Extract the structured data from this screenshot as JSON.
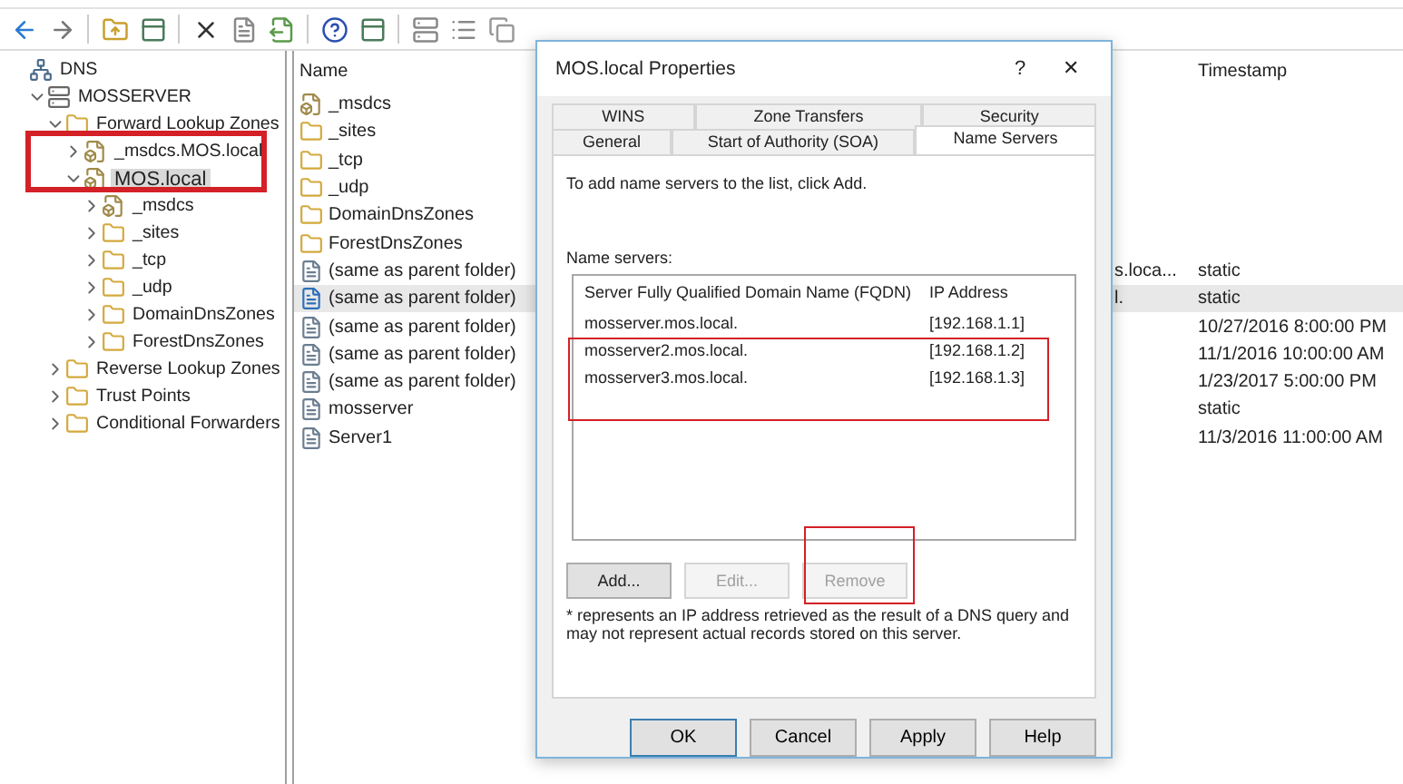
{
  "toolbar": {
    "buttons": [
      {
        "kind": "back"
      },
      {
        "kind": "forward"
      },
      {
        "kind": "sep"
      },
      {
        "kind": "folder-up"
      },
      {
        "kind": "panel"
      },
      {
        "kind": "sep"
      },
      {
        "kind": "delete"
      },
      {
        "kind": "properties"
      },
      {
        "kind": "export"
      },
      {
        "kind": "sep"
      },
      {
        "kind": "help"
      },
      {
        "kind": "panel"
      },
      {
        "kind": "sep"
      },
      {
        "kind": "server"
      },
      {
        "kind": "list"
      },
      {
        "kind": "copy"
      }
    ]
  },
  "tree": [
    {
      "label": "DNS",
      "kind": "dns",
      "selected": false,
      "children": [
        {
          "label": "MOSSERVER",
          "kind": "server",
          "expanded": true,
          "selected": false,
          "children": [
            {
              "label": "Forward Lookup Zones",
              "kind": "folder",
              "expanded": true,
              "selected": false,
              "children": [
                {
                  "label": "_msdcs.MOS.local",
                  "kind": "zone",
                  "expanded": false,
                  "selected": false
                },
                {
                  "label": "MOS.local",
                  "kind": "zone",
                  "expanded": true,
                  "selected": true,
                  "children": [
                    {
                      "label": "_msdcs",
                      "kind": "zone",
                      "expanded": false,
                      "selected": false
                    },
                    {
                      "label": "_sites",
                      "kind": "folder",
                      "expanded": false,
                      "selected": false
                    },
                    {
                      "label": "_tcp",
                      "kind": "folder",
                      "expanded": false,
                      "selected": false
                    },
                    {
                      "label": "_udp",
                      "kind": "folder",
                      "expanded": false,
                      "selected": false
                    },
                    {
                      "label": "DomainDnsZones",
                      "kind": "folder",
                      "expanded": false,
                      "selected": false
                    },
                    {
                      "label": "ForestDnsZones",
                      "kind": "folder",
                      "expanded": false,
                      "selected": false
                    }
                  ]
                }
              ]
            },
            {
              "label": "Reverse Lookup Zones",
              "kind": "folder",
              "expanded": false,
              "selected": false
            },
            {
              "label": "Trust Points",
              "kind": "folder",
              "expanded": false,
              "selected": false
            },
            {
              "label": "Conditional Forwarders",
              "kind": "folder",
              "expanded": false,
              "selected": false
            }
          ]
        }
      ]
    }
  ],
  "list": {
    "columns": [
      "Name",
      "Timestamp"
    ],
    "rows": [
      {
        "name": "_msdcs",
        "kind": "zone",
        "selected": false
      },
      {
        "name": "_sites",
        "kind": "folder",
        "selected": false
      },
      {
        "name": "_tcp",
        "kind": "folder",
        "selected": false
      },
      {
        "name": "_udp",
        "kind": "folder",
        "selected": false
      },
      {
        "name": "DomainDnsZones",
        "kind": "folder",
        "selected": false
      },
      {
        "name": "ForestDnsZones",
        "kind": "folder",
        "selected": false
      },
      {
        "name": "(same as parent folder)",
        "kind": "record",
        "column_2": "s.loca...",
        "timestamp": "static",
        "selected": false
      },
      {
        "name": "(same as parent folder)",
        "kind": "record-blue",
        "column_2": "l.",
        "timestamp": "static",
        "selected": true
      },
      {
        "name": "(same as parent folder)",
        "kind": "record",
        "timestamp": "10/27/2016 8:00:00 PM",
        "selected": false
      },
      {
        "name": "(same as parent folder)",
        "kind": "record",
        "timestamp": "11/1/2016 10:00:00 AM",
        "selected": false
      },
      {
        "name": "(same as parent folder)",
        "kind": "record",
        "timestamp": "1/23/2017 5:00:00 PM",
        "selected": false
      },
      {
        "name": "mosserver",
        "kind": "record",
        "timestamp": "static",
        "selected": false
      },
      {
        "name": "Server1",
        "kind": "record",
        "timestamp": "11/3/2016 11:00:00 AM",
        "selected": false
      }
    ]
  },
  "dialog": {
    "title": "MOS.local Properties",
    "help": "?",
    "close": "✕",
    "tab_rows": [
      [
        {
          "label": "WINS",
          "selected": false
        },
        {
          "label": "Zone Transfers",
          "selected": false
        },
        {
          "label": "Security",
          "selected": false
        }
      ],
      [
        {
          "label": "General",
          "selected": false
        },
        {
          "label": "Start of Authority (SOA)",
          "selected": false
        },
        {
          "label": "Name Servers",
          "selected": true
        }
      ]
    ],
    "instruction": "To add name servers to the list, click Add.",
    "list_label": "Name servers:",
    "columns": [
      "Server Fully Qualified Domain Name (FQDN)",
      "IP Address"
    ],
    "servers": [
      {
        "fqdn": "mosserver.mos.local.",
        "ip": "[192.168.1.1]"
      },
      {
        "fqdn": "mosserver2.mos.local.",
        "ip": "[192.168.1.2]"
      },
      {
        "fqdn": "mosserver3.mos.local.",
        "ip": "[192.168.1.3]"
      }
    ],
    "list_buttons": [
      {
        "label": "Add...",
        "disabled": false
      },
      {
        "label": "Edit...",
        "disabled": true
      },
      {
        "label": "Remove",
        "disabled": true
      }
    ],
    "note": "* represents an IP address retrieved as the result of a DNS query and may not represent actual records stored on this server.",
    "buttons": [
      {
        "label": "OK",
        "default": true
      },
      {
        "label": "Cancel",
        "default": false
      },
      {
        "label": "Apply",
        "default": false
      },
      {
        "label": "Help",
        "default": false
      }
    ]
  }
}
